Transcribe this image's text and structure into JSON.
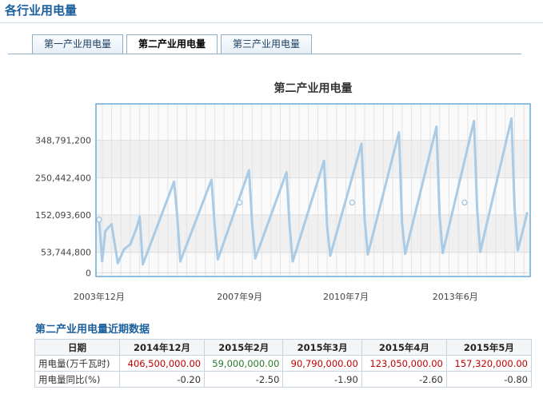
{
  "page": {
    "title": "各行业用电量"
  },
  "tabs": [
    {
      "label": "第一产业用电量",
      "active": false
    },
    {
      "label": "第二产业用电量",
      "active": true
    },
    {
      "label": "第三产业用电量",
      "active": false
    }
  ],
  "chart_data": {
    "type": "line",
    "title": "第二产业用电量",
    "xlabel": "",
    "ylabel": "",
    "x_tick_labels": [
      "2003年12月",
      "2007年9月",
      "2010年7月",
      "2013年6月"
    ],
    "x_tick_dates": [
      "2003-12",
      "2007-09",
      "2010-07",
      "2013-06"
    ],
    "y_ticks": [
      0,
      53744800,
      152093600,
      250442400,
      348791200
    ],
    "y_tick_labels": [
      "0",
      "53,744,800",
      "152,093,600",
      "250,442,400",
      "348,791,200"
    ],
    "ylim": [
      -10000000,
      445000000
    ],
    "xlim": [
      "2003-11",
      "2015-06"
    ],
    "grid": true,
    "legend": "none",
    "series_color": "#a9cbe6",
    "series": [
      {
        "x": [
          "2003-12",
          "2004-01",
          "2004-02",
          "2004-04",
          "2004-06",
          "2004-08",
          "2004-10",
          "2004-12",
          "2005-01",
          "2005-02",
          "2005-12",
          "2006-01",
          "2006-02",
          "2006-12",
          "2007-01",
          "2007-02",
          "2007-12",
          "2008-01",
          "2008-02",
          "2008-12",
          "2009-01",
          "2009-02",
          "2009-12",
          "2010-01",
          "2010-02",
          "2010-12",
          "2011-01",
          "2011-02",
          "2011-12",
          "2012-01",
          "2012-02",
          "2012-12",
          "2013-01",
          "2013-02",
          "2013-12",
          "2014-01",
          "2014-02",
          "2014-12",
          "2015-01",
          "2015-02",
          "2015-03",
          "2015-04",
          "2015-05"
        ],
        "values": [
          140000000,
          30000000,
          110000000,
          128000000,
          25000000,
          62000000,
          75000000,
          118000000,
          148000000,
          22000000,
          240000000,
          150000000,
          30000000,
          245000000,
          125000000,
          35000000,
          270000000,
          130000000,
          38000000,
          265000000,
          120000000,
          30000000,
          295000000,
          120000000,
          45000000,
          340000000,
          140000000,
          48000000,
          370000000,
          130000000,
          50000000,
          385000000,
          150000000,
          52000000,
          400000000,
          170000000,
          55000000,
          406500000,
          170000000,
          59000000,
          90790000,
          123050000,
          157320000
        ]
      }
    ],
    "highlight_points": [
      {
        "x": "2003-12",
        "value": 140000000
      },
      {
        "x": "2007-09",
        "value": 185000000
      },
      {
        "x": "2010-09",
        "value": 185000000
      },
      {
        "x": "2013-09",
        "value": 185000000
      }
    ]
  },
  "table": {
    "title": "第二产业用电量近期数据",
    "header_label": "日期",
    "columns": [
      "2014年12月",
      "2015年2月",
      "2015年3月",
      "2015年4月",
      "2015年5月"
    ],
    "rows": [
      {
        "label": "用电量(万千瓦时)",
        "values": [
          "406,500,000.00",
          "59,000,000.00",
          "90,790,000.00",
          "123,050,000.00",
          "157,320,000.00"
        ],
        "color_codes": [
          "red",
          "green",
          "red",
          "red",
          "red"
        ]
      },
      {
        "label": "用电量同比(%)",
        "values": [
          "-0.20",
          "-2.50",
          "-1.90",
          "-2.60",
          "-0.80"
        ]
      }
    ]
  }
}
